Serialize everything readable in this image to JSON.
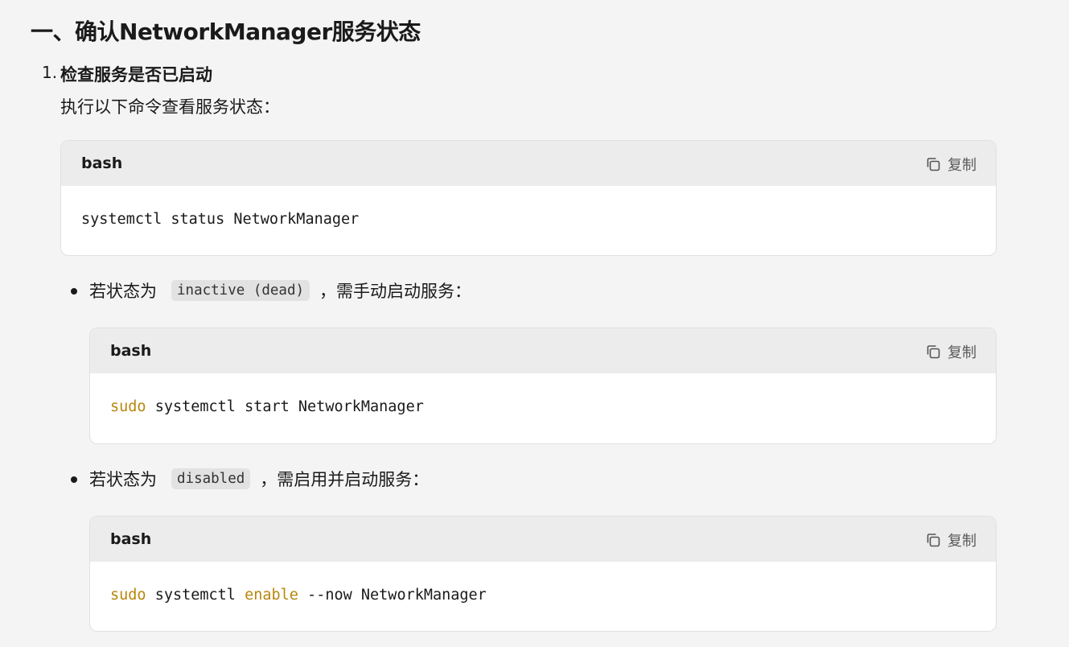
{
  "heading": "一、确认NetworkManager服务状态",
  "step": {
    "number": "1.",
    "title": "检查服务是否已启动",
    "description": "执行以下命令查看服务状态："
  },
  "copy_label": "复制",
  "icons": {
    "copy": "copy-icon"
  },
  "colors": {
    "keyword": "#b8860b"
  },
  "code_blocks": [
    {
      "language": "bash",
      "tokens": [
        "systemctl status NetworkManager"
      ]
    },
    {
      "language": "bash",
      "tokens": [
        "sudo",
        " systemctl start NetworkManager"
      ]
    },
    {
      "language": "bash",
      "tokens": [
        "sudo",
        " systemctl ",
        "enable",
        " --now NetworkManager"
      ]
    }
  ],
  "bullets": [
    {
      "prefix": "若状态为",
      "code": "inactive (dead)",
      "suffix": "，需手动启动服务："
    },
    {
      "prefix": "若状态为",
      "code": "disabled",
      "suffix": "，需启用并启动服务："
    }
  ]
}
